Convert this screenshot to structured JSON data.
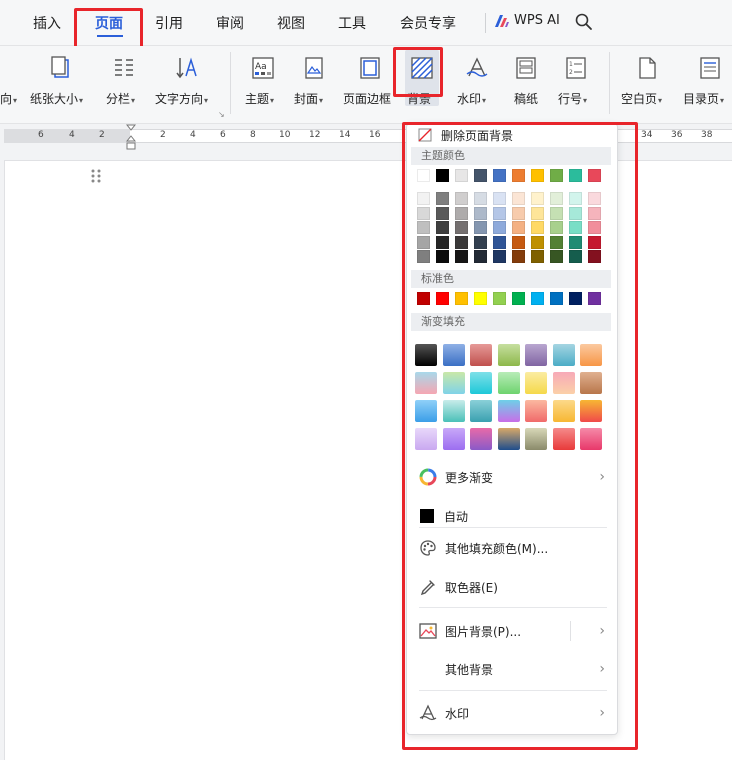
{
  "tabs": [
    {
      "label": "插入"
    },
    {
      "label": "页面",
      "active": true
    },
    {
      "label": "引用"
    },
    {
      "label": "审阅"
    },
    {
      "label": "视图"
    },
    {
      "label": "工具"
    },
    {
      "label": "会员专享"
    }
  ],
  "wps_ai_label": "WPS AI",
  "ribbon": {
    "items": [
      {
        "label": "向",
        "icon": "orientation-icon"
      },
      {
        "label": "纸张大小",
        "icon": "paper-size-icon"
      },
      {
        "label": "分栏",
        "icon": "columns-icon"
      },
      {
        "label": "文字方向",
        "icon": "text-direction-icon"
      },
      {
        "label": "主题",
        "icon": "theme-icon"
      },
      {
        "label": "封面",
        "icon": "cover-icon"
      },
      {
        "label": "页面边框",
        "icon": "page-border-icon"
      },
      {
        "label": "背景",
        "icon": "background-icon"
      },
      {
        "label": "水印",
        "icon": "watermark-icon"
      },
      {
        "label": "稿纸",
        "icon": "manuscript-icon"
      },
      {
        "label": "行号",
        "icon": "line-number-icon"
      },
      {
        "label": "空白页",
        "icon": "blank-page-icon"
      },
      {
        "label": "目录页",
        "icon": "toc-page-icon"
      }
    ]
  },
  "ruler": {
    "numbers": [
      "6",
      "4",
      "2",
      "2",
      "4",
      "6",
      "8",
      "10",
      "12",
      "14",
      "16",
      "34",
      "36",
      "38"
    ]
  },
  "dropdown": {
    "remove_bg": "删除页面背景",
    "theme_colors_title": "主题颜色",
    "theme_colors_top": [
      "#ffffff",
      "#000000",
      "#e7e6e6",
      "#44546a",
      "#4472c4",
      "#ed7d31",
      "#ffc000",
      "#70ad47",
      "#2bbc9c",
      "#e8485a"
    ],
    "theme_colors_shades": [
      [
        "#f2f2f2",
        "#7f7f7f",
        "#d0cece",
        "#d6dce4",
        "#d9e2f3",
        "#fbe5d5",
        "#fff2cc",
        "#e2efd9",
        "#d2f4ec",
        "#fad9dd"
      ],
      [
        "#d8d8d8",
        "#595959",
        "#aeabab",
        "#adb9ca",
        "#b4c6e7",
        "#f7cbac",
        "#fee599",
        "#c5e0b3",
        "#a6e9d9",
        "#f5b4bc"
      ],
      [
        "#bfbfbf",
        "#3f3f3f",
        "#757070",
        "#8496b0",
        "#8eaadb",
        "#f4b183",
        "#ffd965",
        "#a8d08d",
        "#79dec6",
        "#f18e9b"
      ],
      [
        "#a5a5a5",
        "#262626",
        "#3a3838",
        "#323f4f",
        "#2f5496",
        "#c55a11",
        "#bf9000",
        "#538135",
        "#208c74",
        "#c5192f"
      ],
      [
        "#7f7f7f",
        "#0c0c0c",
        "#171616",
        "#222a35",
        "#1f3763",
        "#833c0b",
        "#7f6000",
        "#375623",
        "#155d4d",
        "#83111f"
      ]
    ],
    "standard_title": "标准色",
    "standard_colors": [
      "#c00000",
      "#ff0000",
      "#ffc000",
      "#ffff00",
      "#92d050",
      "#00b050",
      "#00b0f0",
      "#0070c0",
      "#002060",
      "#7030a0"
    ],
    "gradient_title": "渐变填充",
    "gradients": [
      [
        "#000000",
        "#555555"
      ],
      [
        "#3a6fc4",
        "#8fb0e6"
      ],
      [
        "#c0504d",
        "#e69a98"
      ],
      [
        "#8db84a",
        "#c6dfa0"
      ],
      [
        "#8064a2",
        "#b9a6d0"
      ],
      [
        "#4bacc6",
        "#a5d5e2"
      ],
      [
        "#f79646",
        "#fbc9a0"
      ],
      [
        "#f6a6b2",
        "#a8d8ea"
      ],
      [
        "#7fd3e8",
        "#c9e8a8"
      ],
      [
        "#1ec8d8",
        "#7ee0e8"
      ],
      [
        "#6ed36e",
        "#b8ecb8"
      ],
      [
        "#f5d94a",
        "#fbeca2"
      ],
      [
        "#fbd0a8",
        "#f7a9b8"
      ],
      [
        "#b8764a",
        "#e0b090"
      ],
      [
        "#3b9ee8",
        "#8fd0f8"
      ],
      [
        "#4ac0b8",
        "#c8ecea"
      ],
      [
        "#3aa0b0",
        "#8ad0d8"
      ],
      [
        "#c86ee8",
        "#6ed0e8"
      ],
      [
        "#f06a6a",
        "#fbb8a0"
      ],
      [
        "#f7b733",
        "#fcd98a"
      ],
      [
        "#f04a4a",
        "#f7b733"
      ],
      [
        "#c9a8f0",
        "#e8d8fa"
      ],
      [
        "#9c6ef0",
        "#c8a8f8"
      ],
      [
        "#8a5ac8",
        "#e86aa8"
      ],
      [
        "#1f4e8c",
        "#d8a868"
      ],
      [
        "#8a8a6a",
        "#d8d8b8"
      ],
      [
        "#e83a3a",
        "#f58a8a"
      ],
      [
        "#e8386a",
        "#f58aa8"
      ]
    ],
    "more_gradient": "更多渐变",
    "auto": "自动",
    "other_fill": "其他填充颜色(M)...",
    "eyedropper": "取色器(E)",
    "picture_bg": "图片背景(P)...",
    "other_bg": "其他背景",
    "watermark": "水印"
  },
  "colors": {
    "accent": "#2b5fd9",
    "highlight": "#e8252b"
  }
}
